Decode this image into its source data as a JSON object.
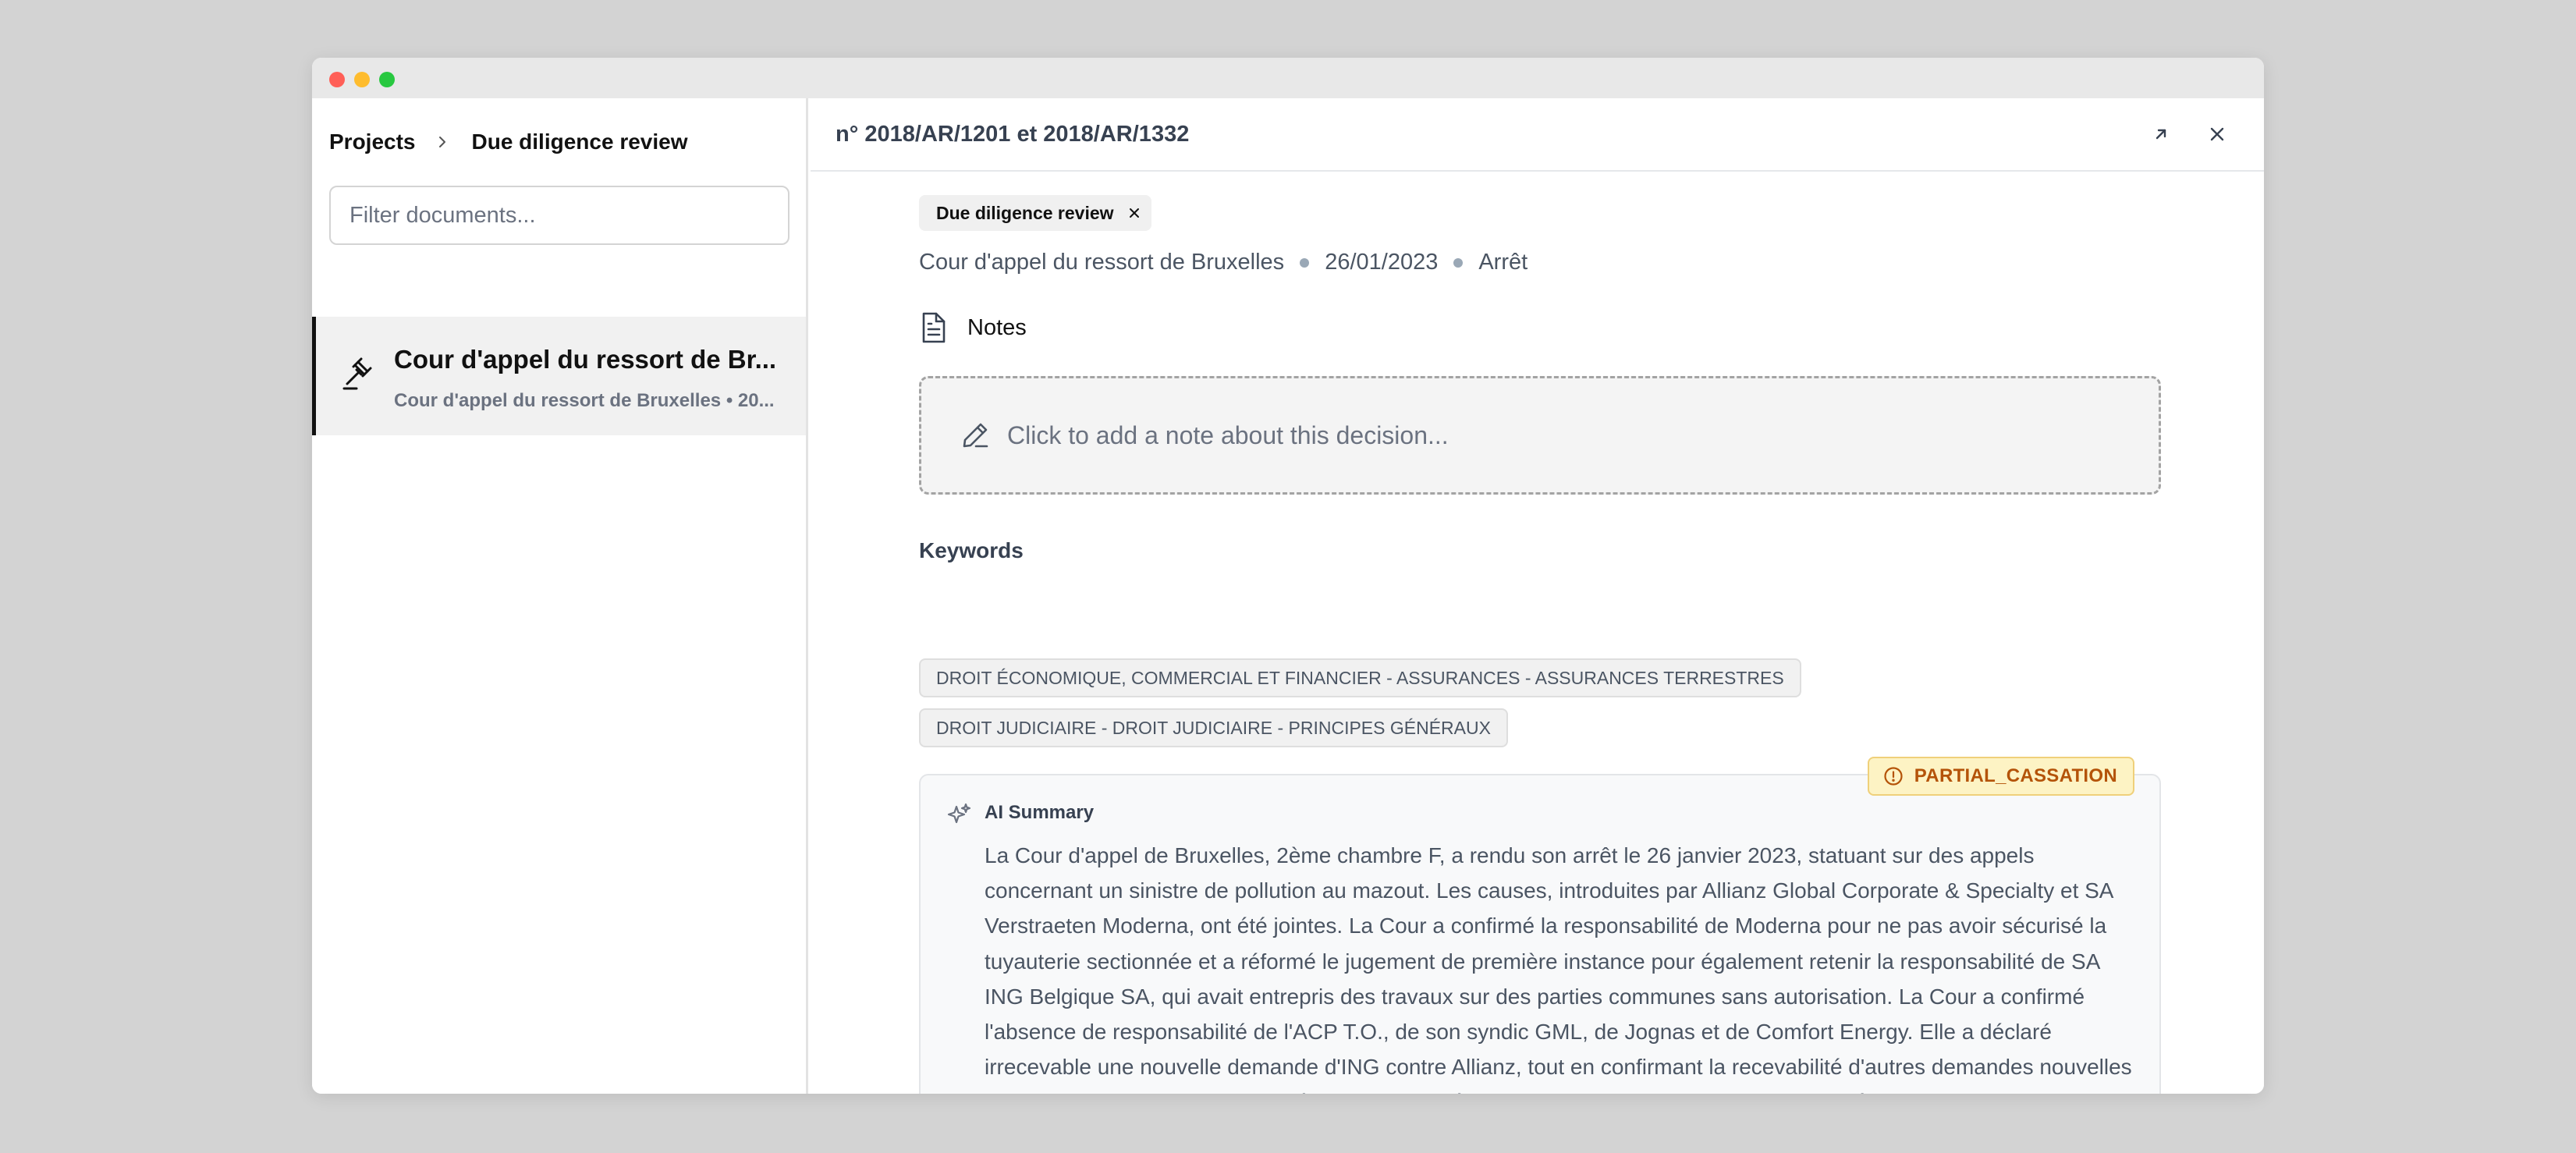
{
  "sidebar": {
    "breadcrumb": {
      "root": "Projects",
      "current": "Due diligence review"
    },
    "filter_placeholder": "Filter documents...",
    "documents": [
      {
        "title": "Cour d'appel du ressort de Br...",
        "subtitle": "Cour d'appel du ressort de Bruxelles • 20..."
      }
    ]
  },
  "main": {
    "title": "n° 2018/AR/1201 et 2018/AR/1332",
    "tag": "Due diligence review",
    "meta": {
      "court": "Cour d'appel du ressort de Bruxelles",
      "date": "26/01/2023",
      "type": "Arrêt"
    },
    "notes_label": "Notes",
    "note_placeholder": "Click to add a note about this decision...",
    "keywords_title": "Keywords",
    "keywords": [
      "DROIT ÉCONOMIQUE, COMMERCIAL ET FINANCIER - ASSURANCES - ASSURANCES TERRESTRES",
      "DROIT JUDICIAIRE - DROIT JUDICIAIRE - PRINCIPES GÉNÉRAUX"
    ],
    "summary": {
      "badge": "PARTIAL_CASSATION",
      "title": "AI Summary",
      "text": "La Cour d'appel de Bruxelles, 2ème chambre F, a rendu son arrêt le 26 janvier 2023, statuant sur des appels concernant un sinistre de pollution au mazout. Les causes, introduites par Allianz Global Corporate & Specialty et SA Verstraeten Moderna, ont été jointes. La Cour a confirmé la responsabilité de Moderna pour ne pas avoir sécurisé la tuyauterie sectionnée et a réformé le jugement de première instance pour également retenir la responsabilité de SA ING Belgique SA, qui avait entrepris des travaux sur des parties communes sans autorisation. La Cour a confirmé l'absence de responsabilité de l'ACP T.O., de son syndic GML, de Jognas et de Comfort Energy. Elle a déclaré irrecevable une nouvelle demande d'ING contre Allianz, tout en confirmant la recevabilité d'autres demandes nouvelles et d'appels incidents. La Cour a également statué sur la couverture d'assurance d'Allianz, écartant l'application d'une clause d'exclusion pour pollution accidentelle."
    }
  },
  "colors": {
    "badge_bg": "#fdf3c4",
    "badge_text": "#b45309",
    "active_item_border": "#111111"
  }
}
